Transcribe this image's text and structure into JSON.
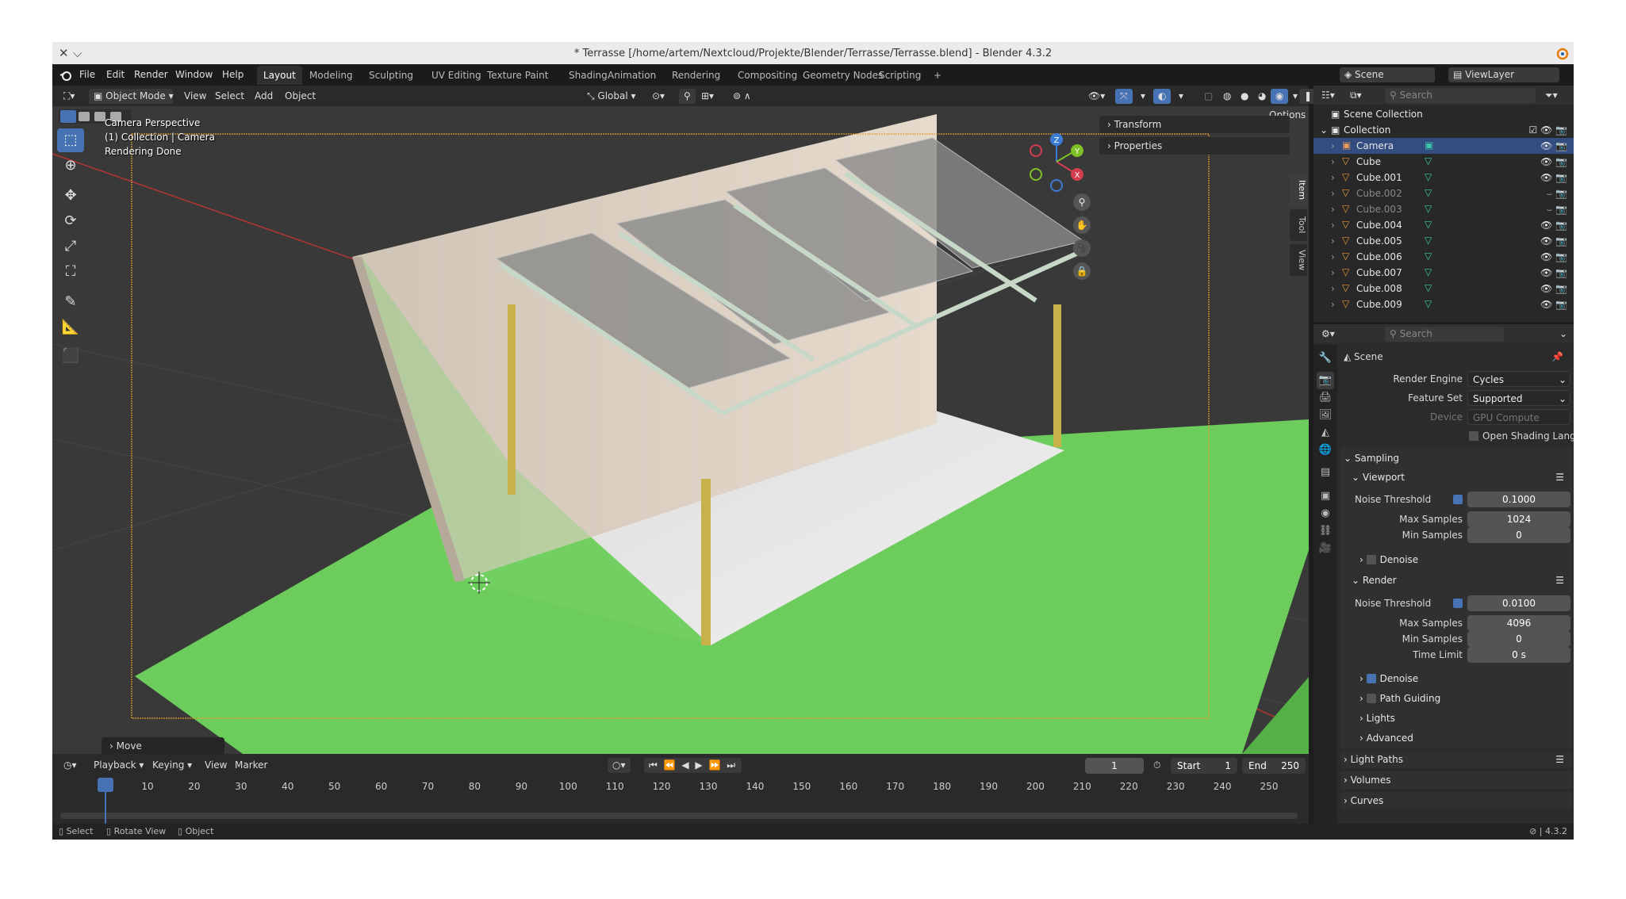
{
  "titlebar": {
    "title": "* Terrasse [/home/artem/Nextcloud/Projekte/Blender/Terrasse/Terrasse.blend] - Blender 4.3.2",
    "close_glyph": "✕",
    "chevron_glyph": "⌵"
  },
  "menubar": {
    "items": [
      "File",
      "Edit",
      "Render",
      "Window",
      "Help"
    ],
    "workspaces": [
      "Layout",
      "Modeling",
      "Sculpting",
      "UV Editing",
      "Texture Paint",
      "Shading",
      "Animation",
      "Rendering",
      "Compositing",
      "Geometry Nodes",
      "Scripting"
    ],
    "active_workspace": "Layout",
    "add_tab": "+",
    "scene": "Scene",
    "view_layer": "ViewLayer"
  },
  "viewport_header": {
    "mode": "Object Mode",
    "menus": [
      "View",
      "Select",
      "Add",
      "Object"
    ],
    "orientation": "Global",
    "options": "Options"
  },
  "viewport": {
    "overlay_lines": [
      "Camera Perspective",
      "(1) Collection | Camera",
      "Rendering Done"
    ],
    "npanel_sections": [
      "Transform",
      "Properties"
    ],
    "side_tabs": [
      "Item",
      "Tool",
      "View"
    ],
    "last_op": "Move",
    "gizmo_axes": {
      "x": "X",
      "y": "Y",
      "z": "Z"
    }
  },
  "timeline": {
    "menus": [
      "Playback",
      "Keying",
      "View",
      "Marker"
    ],
    "current_frame": "1",
    "start_label": "Start",
    "start": "1",
    "end_label": "End",
    "end": "250",
    "ruler": [
      "1",
      "10",
      "20",
      "30",
      "40",
      "50",
      "60",
      "70",
      "80",
      "90",
      "100",
      "110",
      "120",
      "130",
      "140",
      "150",
      "160",
      "170",
      "180",
      "190",
      "200",
      "210",
      "220",
      "230",
      "240",
      "250"
    ]
  },
  "statusbar": {
    "items": [
      "Select",
      "Rotate View",
      "Object"
    ],
    "version": "4.3.2"
  },
  "outliner": {
    "search_placeholder": "Search",
    "root": "Scene Collection",
    "collection": "Collection",
    "objects": [
      {
        "name": "Camera",
        "selected": true,
        "dim": false
      },
      {
        "name": "Cube",
        "selected": false,
        "dim": false
      },
      {
        "name": "Cube.001",
        "selected": false,
        "dim": false
      },
      {
        "name": "Cube.002",
        "selected": false,
        "dim": true
      },
      {
        "name": "Cube.003",
        "selected": false,
        "dim": true
      },
      {
        "name": "Cube.004",
        "selected": false,
        "dim": false
      },
      {
        "name": "Cube.005",
        "selected": false,
        "dim": false
      },
      {
        "name": "Cube.006",
        "selected": false,
        "dim": false
      },
      {
        "name": "Cube.007",
        "selected": false,
        "dim": false
      },
      {
        "name": "Cube.008",
        "selected": false,
        "dim": false
      },
      {
        "name": "Cube.009",
        "selected": false,
        "dim": false
      }
    ]
  },
  "properties": {
    "search_placeholder": "Search",
    "context": "Scene",
    "render_engine_label": "Render Engine",
    "render_engine": "Cycles",
    "feature_set_label": "Feature Set",
    "feature_set": "Supported",
    "device_label": "Device",
    "device": "GPU Compute",
    "osl": "Open Shading Language",
    "sampling": "Sampling",
    "viewport": {
      "title": "Viewport",
      "noise_threshold_label": "Noise Threshold",
      "noise_threshold": "0.1000",
      "max_samples_label": "Max Samples",
      "max_samples": "1024",
      "min_samples_label": "Min Samples",
      "min_samples": "0",
      "denoise": "Denoise"
    },
    "render": {
      "title": "Render",
      "noise_threshold_label": "Noise Threshold",
      "noise_threshold": "0.0100",
      "max_samples_label": "Max Samples",
      "max_samples": "4096",
      "min_samples_label": "Min Samples",
      "min_samples": "0",
      "time_limit_label": "Time Limit",
      "time_limit": "0 s",
      "denoise": "Denoise"
    },
    "subpanels": [
      "Path Guiding",
      "Lights",
      "Advanced"
    ],
    "panels": [
      "Light Paths",
      "Volumes",
      "Curves"
    ]
  },
  "colors": {
    "accent": "#4772b3",
    "selection": "#334d80",
    "ground": "#6ccc5c",
    "wall": "#d8ccbf",
    "post": "#c8b04a"
  }
}
